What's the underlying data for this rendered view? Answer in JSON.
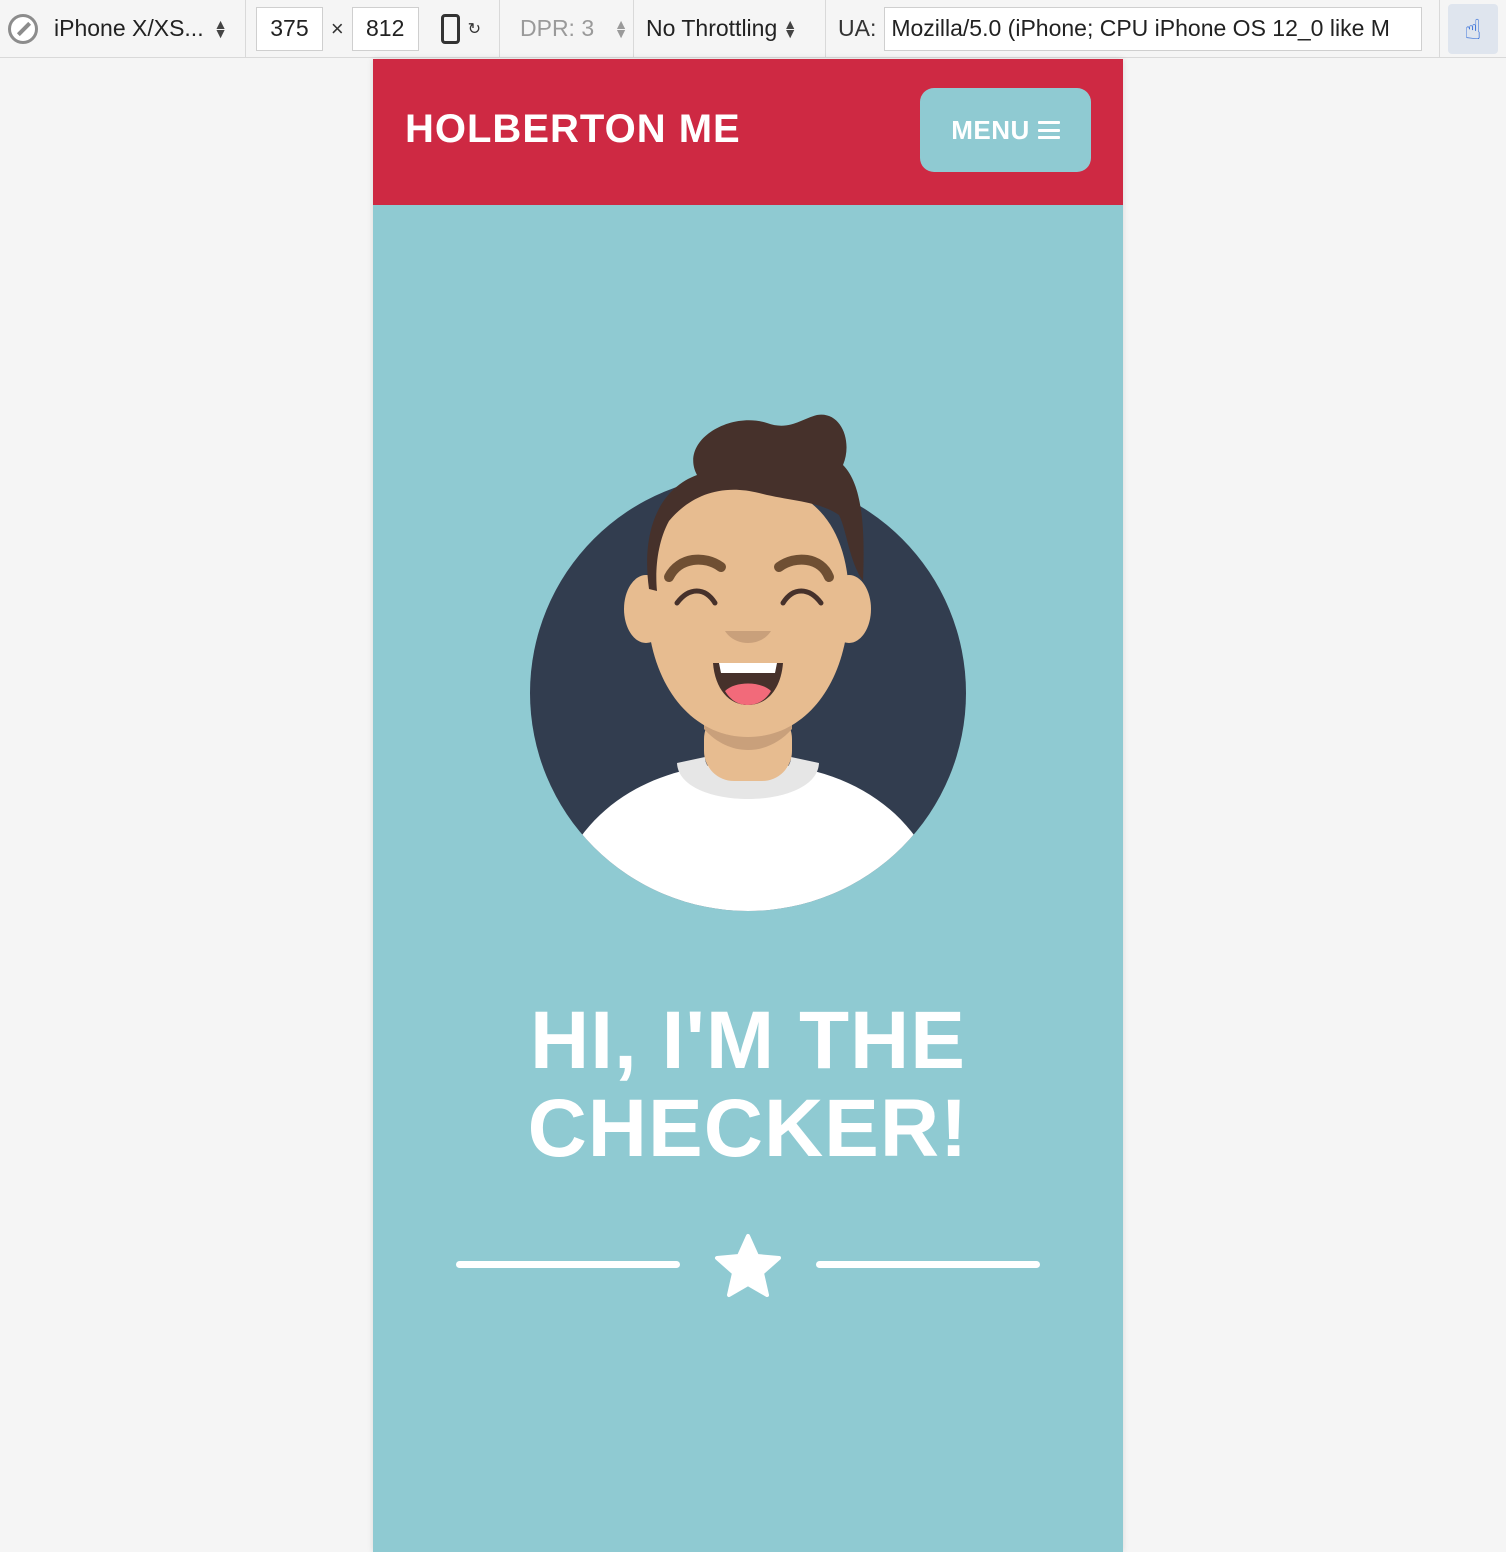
{
  "devtools": {
    "device": "iPhone X/XS...",
    "width": "375",
    "times": "×",
    "height": "812",
    "dpr": "DPR: 3",
    "throttling": "No Throttling",
    "ua_label": "UA:",
    "ua_value": "Mozilla/5.0 (iPhone; CPU iPhone OS 12_0 like M"
  },
  "site": {
    "brand": "HOLBERTON ME",
    "menu_label": "MENU",
    "headline_line1": "HI, I'M THE",
    "headline_line2": "CHECKER!"
  },
  "colors": {
    "header": "#ce2943",
    "background": "#8fcad2",
    "avatar_circle": "#323d4f",
    "text": "#ffffff"
  },
  "icons": [
    "compass-icon",
    "updown-icon",
    "rotate-icon",
    "touch-icon",
    "hamburger-icon",
    "star-icon"
  ]
}
